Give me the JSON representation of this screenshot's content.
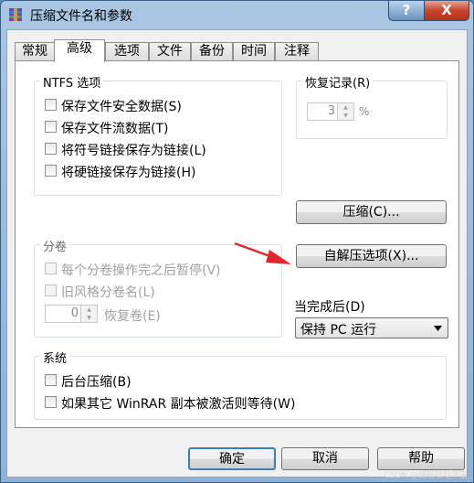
{
  "window": {
    "title": "压缩文件名和参数",
    "help_label": "?",
    "close_label": "X"
  },
  "tabs": [
    {
      "label": "常规"
    },
    {
      "label": "高级"
    },
    {
      "label": "选项"
    },
    {
      "label": "文件"
    },
    {
      "label": "备份"
    },
    {
      "label": "时间"
    },
    {
      "label": "注释"
    }
  ],
  "ntfs": {
    "title": "NTFS 选项",
    "items": [
      {
        "label": "保存文件安全数据(S)"
      },
      {
        "label": "保存文件流数据(T)"
      },
      {
        "label": "将符号链接保存为链接(L)"
      },
      {
        "label": "将硬链接保存为链接(H)"
      }
    ]
  },
  "recovery": {
    "title": "恢复记录(R)",
    "value": "3",
    "unit": "%"
  },
  "compress_button": "压缩(C)...",
  "sfx_button": "自解压选项(X)...",
  "volume": {
    "title": "分卷",
    "items": [
      {
        "label": "每个分卷操作完之后暂停(V)"
      },
      {
        "label": "旧风格分卷名(L)"
      }
    ],
    "recovery_volumes_value": "0",
    "recovery_volumes_label": "恢复卷(E)"
  },
  "when_done": {
    "label": "当完成后(D)",
    "selected": "保持 PC 运行"
  },
  "system": {
    "title": "系统",
    "items": [
      {
        "label": "后台压缩(B)"
      },
      {
        "label": "如果其它 WinRAR 副本被激活则等待(W)"
      }
    ]
  },
  "footer": {
    "ok": "确定",
    "cancel": "取消",
    "help": "帮助"
  },
  "watermark": "CSDN @编程哒哒宇宙"
}
